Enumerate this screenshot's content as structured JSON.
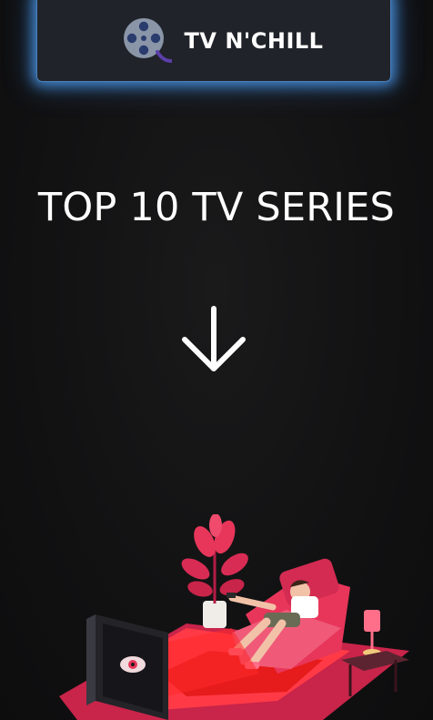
{
  "header": {
    "logo_icon": "film-reel-icon",
    "brand_name": "TV N'CHILL",
    "border_glow_color": "#4a96e6"
  },
  "hero": {
    "title": "TOP 10 TV SERIES",
    "scroll_icon": "arrow-down-icon"
  },
  "illustration": {
    "subject": "person-relaxing-watching-tv-illustration",
    "accent_color": "#e8365a"
  },
  "colors": {
    "background": "#111112",
    "card": "#202329",
    "text": "#ffffff",
    "accent_red": "#e8365a"
  }
}
